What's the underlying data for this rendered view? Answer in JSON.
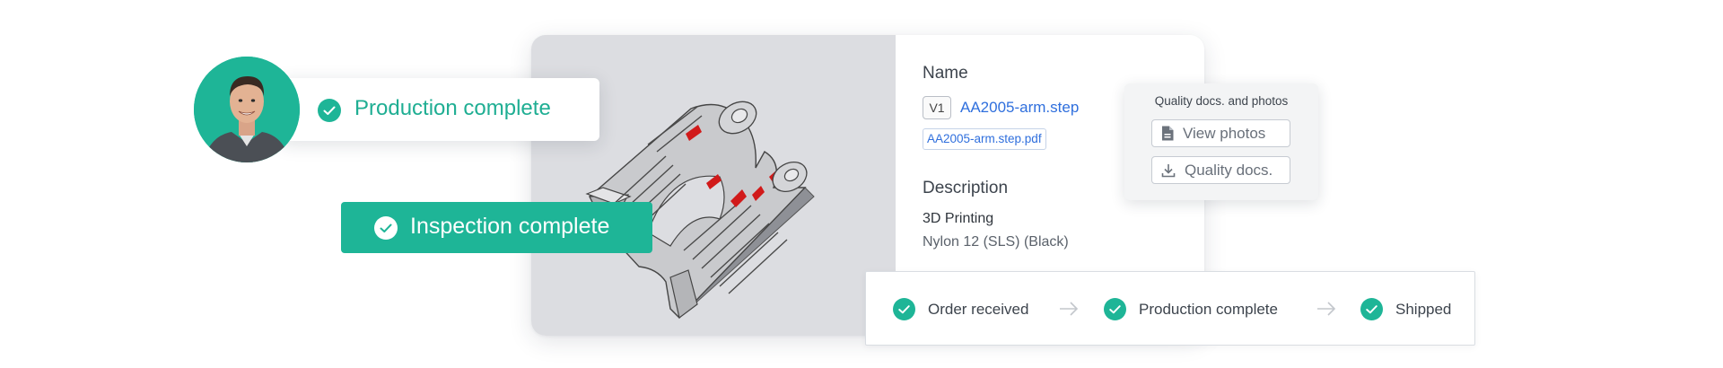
{
  "production_badge": {
    "label": "Production complete"
  },
  "inspection_badge": {
    "label": "Inspection complete"
  },
  "details": {
    "name_title": "Name",
    "version": "V1",
    "file_name": "AA2005-arm.step",
    "pdf_name": "AA2005-arm.step.pdf",
    "description_title": "Description",
    "process": "3D Printing",
    "material": "Nylon 12 (SLS) (Black)"
  },
  "quality_popover": {
    "title": "Quality docs. and photos",
    "view_photos": "View photos",
    "quality_docs": "Quality docs."
  },
  "tracker": {
    "steps": [
      {
        "label": "Order received",
        "done": true
      },
      {
        "label": "Production complete",
        "done": true
      },
      {
        "label": "Shipped",
        "done": true
      }
    ]
  },
  "colors": {
    "accent_green": "#1eb597",
    "link_blue": "#2f6fdd",
    "preview_bg": "#dcdde1",
    "part_highlight": "#d11a1a"
  },
  "icons": {
    "check": "check-circle-icon",
    "document": "document-icon",
    "download": "download-icon",
    "arrow": "arrow-right-icon"
  }
}
